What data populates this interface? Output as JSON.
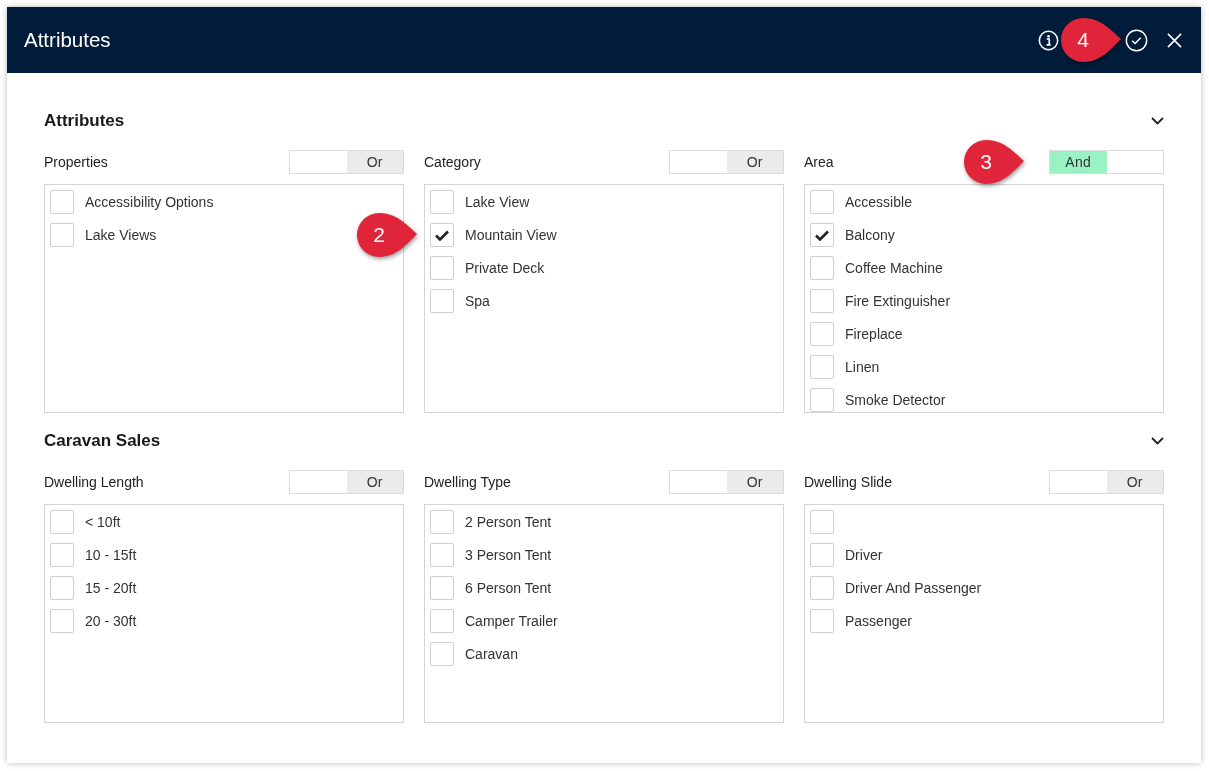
{
  "window": {
    "title": "Attributes",
    "actions": [
      {
        "kind": "info"
      },
      {
        "kind": "confirm",
        "callout": "4"
      },
      {
        "kind": "close"
      }
    ]
  },
  "sections": [
    {
      "title": "Attributes",
      "columns": [
        {
          "label": "Properties",
          "switch": {
            "label": "Or",
            "on": false
          },
          "items": [
            {
              "label": "Accessibility Options",
              "checked": false
            },
            {
              "label": "Lake Views",
              "checked": false
            }
          ]
        },
        {
          "label": "Category",
          "switch": {
            "label": "Or",
            "on": false
          },
          "items": [
            {
              "label": "Lake View",
              "checked": false
            },
            {
              "label": "Mountain View",
              "checked": true,
              "callout": "2"
            },
            {
              "label": "Private Deck",
              "checked": false
            },
            {
              "label": "Spa",
              "checked": false
            }
          ]
        },
        {
          "label": "Area",
          "switch": {
            "label": "And",
            "on": true,
            "callout": "3"
          },
          "items": [
            {
              "label": "Accessible",
              "checked": false
            },
            {
              "label": "Balcony",
              "checked": true
            },
            {
              "label": "Coffee Machine",
              "checked": false
            },
            {
              "label": "Fire Extinguisher",
              "checked": false
            },
            {
              "label": "Fireplace",
              "checked": false
            },
            {
              "label": "Linen",
              "checked": false
            },
            {
              "label": "Smoke Detector",
              "checked": false
            }
          ]
        }
      ]
    },
    {
      "title": "Caravan Sales",
      "columns": [
        {
          "label": "Dwelling Length",
          "switch": {
            "label": "Or",
            "on": false
          },
          "items": [
            {
              "label": "< 10ft",
              "checked": false
            },
            {
              "label": "10 - 15ft",
              "checked": false
            },
            {
              "label": "15 - 20ft",
              "checked": false
            },
            {
              "label": "20 - 30ft",
              "checked": false
            }
          ]
        },
        {
          "label": "Dwelling Type",
          "switch": {
            "label": "Or",
            "on": false
          },
          "items": [
            {
              "label": "2 Person Tent",
              "checked": false
            },
            {
              "label": "3 Person Tent",
              "checked": false
            },
            {
              "label": "6 Person Tent",
              "checked": false
            },
            {
              "label": "Camper Trailer",
              "checked": false
            },
            {
              "label": "Caravan",
              "checked": false
            }
          ]
        },
        {
          "label": "Dwelling Slide",
          "switch": {
            "label": "Or",
            "on": false
          },
          "items": [
            {
              "checked": false
            },
            {
              "label": "Driver",
              "checked": false
            },
            {
              "label": "Driver And Passenger",
              "checked": false
            },
            {
              "label": "Passenger",
              "checked": false
            }
          ]
        }
      ]
    }
  ]
}
